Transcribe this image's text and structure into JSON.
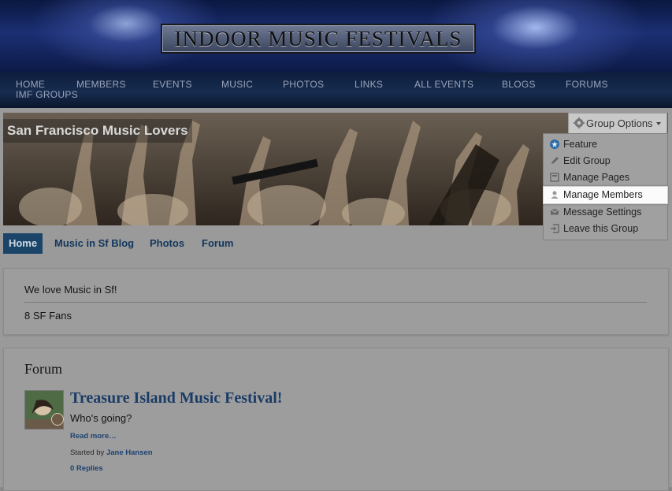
{
  "site": {
    "logo_text": "INDOOR MUSIC FESTIVALS"
  },
  "nav": {
    "items": [
      {
        "label": "HOME"
      },
      {
        "label": "MEMBERS"
      },
      {
        "label": "EVENTS"
      },
      {
        "label": "MUSIC"
      },
      {
        "label": "PHOTOS"
      },
      {
        "label": "LINKS"
      },
      {
        "label": "ALL EVENTS"
      },
      {
        "label": "BLOGS"
      },
      {
        "label": "FORUMS"
      },
      {
        "label": "IMF GROUPS"
      }
    ]
  },
  "group": {
    "title": "San Francisco Music Lovers",
    "options_label": "Group Options",
    "menu": [
      {
        "label": "Feature",
        "icon": "star-badge-icon"
      },
      {
        "label": "Edit Group",
        "icon": "pencil-icon"
      },
      {
        "label": "Manage Pages",
        "icon": "page-icon"
      },
      {
        "label": "Manage Members",
        "icon": "person-icon",
        "active": true
      },
      {
        "label": "Message Settings",
        "icon": "envelope-icon"
      },
      {
        "label": "Leave this Group",
        "icon": "exit-icon"
      }
    ]
  },
  "tabs": [
    {
      "label": "Home",
      "selected": true
    },
    {
      "label": "Music in Sf Blog"
    },
    {
      "label": "Photos"
    },
    {
      "label": "Forum"
    }
  ],
  "info": {
    "description": "We love Music in Sf!",
    "fans": "8 SF Fans"
  },
  "forum": {
    "heading": "Forum",
    "topic": {
      "title": "Treasure Island Music Festival!",
      "body": "Who's going?",
      "read_more": "Read more…",
      "started_by_prefix": "Started by",
      "author": "Jane Hansen",
      "replies": "0 Replies"
    }
  },
  "colors": {
    "nav_bg": "#162c50",
    "tab_selected_bg": "#1a4569",
    "link": "#1a3c66",
    "overlay_dim": "#9a9a9a"
  }
}
